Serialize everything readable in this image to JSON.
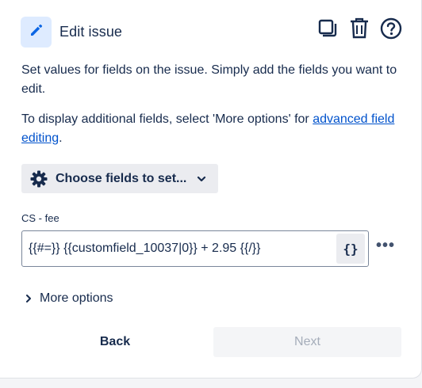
{
  "header": {
    "title": "Edit issue",
    "icons": [
      "pencil-icon",
      "copy-icon",
      "trash-icon",
      "help-icon"
    ],
    "accent": "#deebff"
  },
  "description": {
    "line1": "Set values for fields on the issue. Simply add the fields you want to edit.",
    "line2_prefix": "To display additional fields, select 'More options' for ",
    "line2_link": "advanced field editing",
    "line2_suffix": "."
  },
  "choose_fields": {
    "label": "Choose fields to set...",
    "icons": [
      "gear-icon",
      "chevron-down-icon"
    ]
  },
  "field": {
    "label": "CS - fee",
    "value": "{{#=}} {{customfield_10037|0}} + 2.95 {{/}}",
    "smart_value_button": "{}",
    "more_label": "•••"
  },
  "more_options": {
    "label": "More options"
  },
  "footer": {
    "back_label": "Back",
    "next_label": "Next"
  },
  "colors": {
    "text": "#172b4d",
    "link": "#0052cc",
    "button_bg": "#ebecf0",
    "disabled_text": "#a5adba"
  }
}
